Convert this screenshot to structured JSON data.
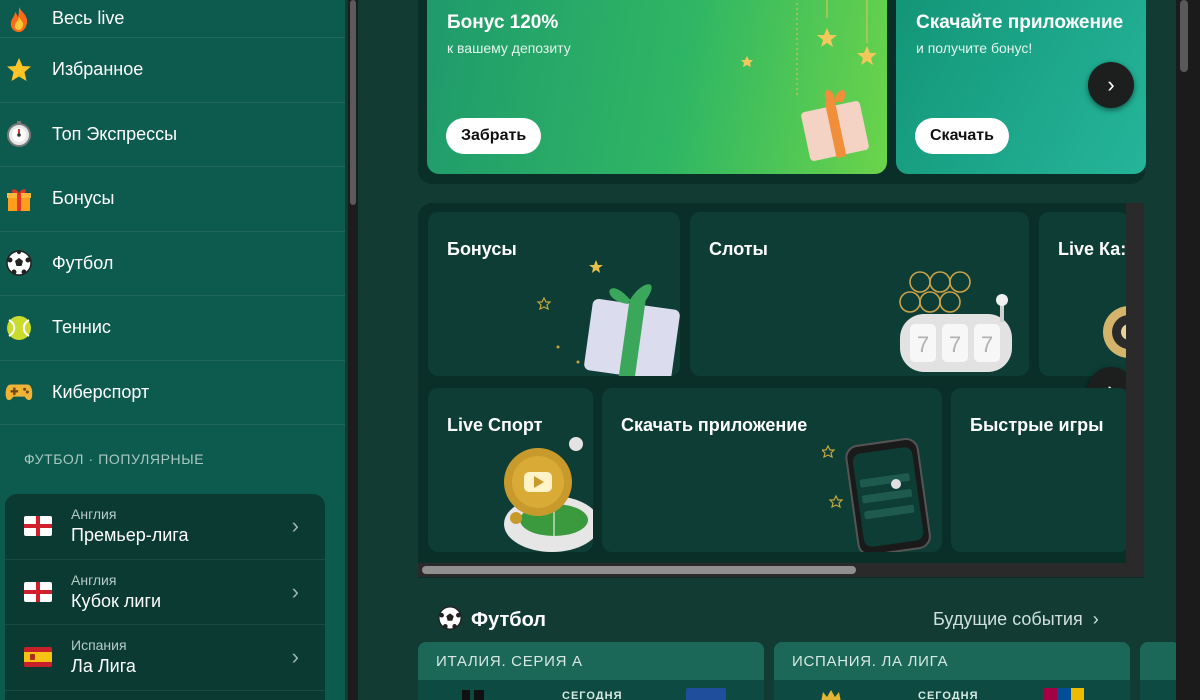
{
  "sidebar": {
    "nav": [
      {
        "icon": "fire-icon",
        "label": "Весь live"
      },
      {
        "icon": "star-icon",
        "label": "Избранное"
      },
      {
        "icon": "stopwatch-icon",
        "label": "Топ Экспрессы"
      },
      {
        "icon": "gift-icon",
        "label": "Бонусы"
      },
      {
        "icon": "soccer-ball-icon",
        "label": "Футбол"
      },
      {
        "icon": "tennis-ball-icon",
        "label": "Теннис"
      },
      {
        "icon": "gamepad-icon",
        "label": "Киберспорт"
      }
    ],
    "section_title": "ФУТБОЛ · ПОПУЛЯРНЫЕ",
    "leagues": [
      {
        "flag": "england-flag-icon",
        "country": "Англия",
        "name": "Премьер-лига"
      },
      {
        "flag": "england-flag-icon",
        "country": "Англия",
        "name": "Кубок лиги"
      },
      {
        "flag": "spain-flag-icon",
        "country": "Испания",
        "name": "Ла Лига"
      }
    ]
  },
  "promos": [
    {
      "title": "Бонус 120%",
      "subtitle": "к вашему депозиту",
      "button": "Забрать"
    },
    {
      "title": "Скачайте приложение",
      "subtitle": "и получите бонус!",
      "button": "Скачать"
    }
  ],
  "tiles": {
    "row1": [
      "Бонусы",
      "Слоты",
      "Live Ка:"
    ],
    "row2": [
      "Live Спорт",
      "Скачать приложение",
      "Быстрые игры"
    ]
  },
  "football": {
    "title": "Футбол",
    "future_link": "Будущие события",
    "cards": [
      {
        "league": "ИТАЛИЯ. СЕРИЯ А",
        "today": "СЕГОДНЯ"
      },
      {
        "league": "ИСПАНИЯ. ЛА ЛИГА",
        "today": "СЕГОДНЯ"
      }
    ]
  },
  "colors": {
    "sidebar_bg": "#0d5a4e",
    "main_bg": "#113b33",
    "promo_green": "#2fb664",
    "promo_teal": "#139577"
  }
}
